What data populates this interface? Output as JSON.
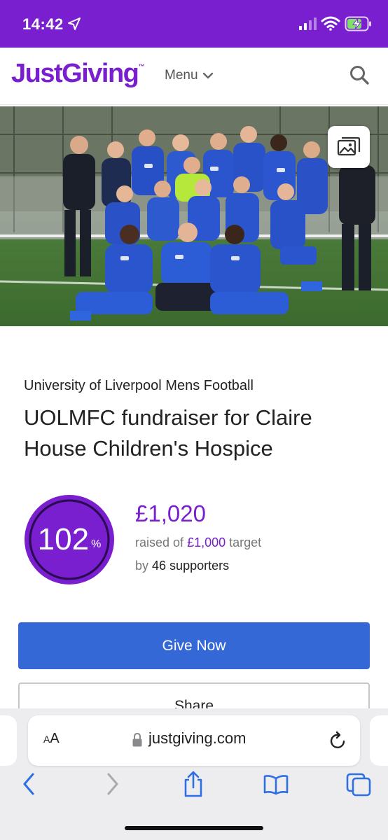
{
  "status_bar": {
    "time": "14:42",
    "location_icon": "location-arrow-icon",
    "signal_icon": "cellular-signal-icon",
    "wifi_icon": "wifi-icon",
    "battery_icon": "battery-charging-icon",
    "background_color": "#7a1fd0"
  },
  "header": {
    "logo_text": "JustGiving",
    "logo_tm": "™",
    "menu_label": "Menu",
    "menu_icon": "chevron-down-icon",
    "search_icon": "search-icon",
    "brand_color": "#7a1fd0"
  },
  "hero": {
    "image": "team-photo",
    "gallery_icon": "image-gallery-icon"
  },
  "page": {
    "organisation": "University of Liverpool Mens Football",
    "title": "UOLMFC fundraiser for Claire House Children's Hospice"
  },
  "progress": {
    "percent_value": "102",
    "percent_sign": "%",
    "fraction": 1.02,
    "raised_amount": "£1,020",
    "raised_of_label": "raised of",
    "target_amount": "£1,000",
    "target_label": "target",
    "by_label": "by",
    "supporters_text": "46 supporters"
  },
  "actions": {
    "give_now_label": "Give Now",
    "give_now_color": "#3468d6",
    "share_label": "Share"
  },
  "browser": {
    "text_size_label_big": "A",
    "text_size_label_small": "A",
    "lock_icon": "lock-icon",
    "url": "justgiving.com",
    "reload_icon": "reload-icon",
    "toolbar": {
      "back_icon": "back-chevron-icon",
      "forward_icon": "forward-chevron-icon",
      "share_icon": "share-icon",
      "bookmarks_icon": "book-icon",
      "tabs_icon": "tabs-icon"
    }
  }
}
